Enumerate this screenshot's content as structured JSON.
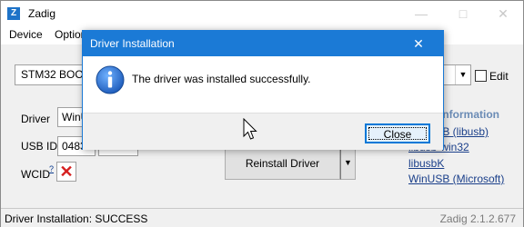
{
  "main_window": {
    "title": "Zadig",
    "menu": [
      "Device",
      "Options"
    ],
    "device_selected": "STM32  BOOTLOADER",
    "edit_label": "Edit",
    "driver_label": "Driver",
    "driver_value": "WinUSB",
    "usbid_label": "USB ID",
    "usbid_value1": "0483",
    "wcid_label": "WCID",
    "wcid_help": "?",
    "wcid_status_glyph": "✕",
    "reinstall_label": "Reinstall Driver",
    "info_heading": "information",
    "info_links": [
      "WinUSB (libusb)",
      "libusb-win32",
      "libusbK",
      "WinUSB (Microsoft)"
    ],
    "status_text": "Driver Installation: SUCCESS",
    "version": "Zadig 2.1.2.677"
  },
  "dialog": {
    "title": "Driver Installation",
    "message": "The driver was installed successfully.",
    "close_label": "Close",
    "icon": "info-icon"
  },
  "colors": {
    "dialog_title_bg": "#1b7ad6",
    "link": "#1a3f8a",
    "wcid_x": "#d62020"
  }
}
